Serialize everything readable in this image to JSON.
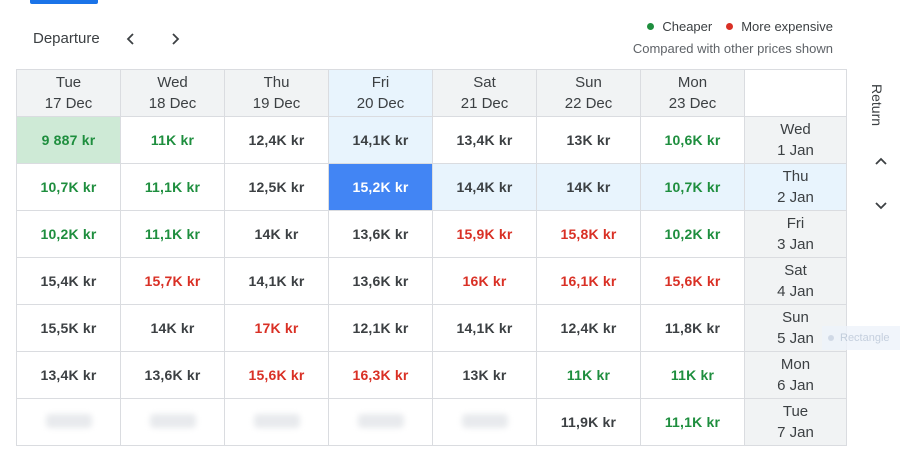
{
  "header": {
    "departure_label": "Departure"
  },
  "legend": {
    "cheaper": "Cheaper",
    "more_expensive": "More expensive",
    "note": "Compared with other prices shown",
    "cheaper_color": "#1e8e3e",
    "expensive_color": "#d93025"
  },
  "return_label": "Return",
  "ghost_label": "Rectangle",
  "columns": [
    {
      "day": "Tue",
      "date": "17 Dec"
    },
    {
      "day": "Wed",
      "date": "18 Dec"
    },
    {
      "day": "Thu",
      "date": "19 Dec"
    },
    {
      "day": "Fri",
      "date": "20 Dec"
    },
    {
      "day": "Sat",
      "date": "21 Dec"
    },
    {
      "day": "Sun",
      "date": "22 Dec"
    },
    {
      "day": "Mon",
      "date": "23 Dec"
    }
  ],
  "rows": [
    {
      "day": "Wed",
      "date": "1 Jan",
      "cells": [
        "9 887 kr",
        "11K kr",
        "12,4K kr",
        "14,1K kr",
        "13,4K kr",
        "13K kr",
        "10,6K kr"
      ]
    },
    {
      "day": "Thu",
      "date": "2 Jan",
      "cells": [
        "10,7K kr",
        "11,1K kr",
        "12,5K kr",
        "15,2K kr",
        "14,4K kr",
        "14K kr",
        "10,7K kr"
      ]
    },
    {
      "day": "Fri",
      "date": "3 Jan",
      "cells": [
        "10,2K kr",
        "11,1K kr",
        "14K kr",
        "13,6K kr",
        "15,9K kr",
        "15,8K kr",
        "10,2K kr"
      ]
    },
    {
      "day": "Sat",
      "date": "4 Jan",
      "cells": [
        "15,4K kr",
        "15,7K kr",
        "14,1K kr",
        "13,6K kr",
        "16K kr",
        "16,1K kr",
        "15,6K kr"
      ]
    },
    {
      "day": "Sun",
      "date": "5 Jan",
      "cells": [
        "15,5K kr",
        "14K kr",
        "17K kr",
        "12,1K kr",
        "14,1K kr",
        "12,4K kr",
        "11,8K kr"
      ]
    },
    {
      "day": "Mon",
      "date": "6 Jan",
      "cells": [
        "13,4K kr",
        "13,6K kr",
        "15,6K kr",
        "16,3K kr",
        "13K kr",
        "11K kr",
        "11K kr"
      ]
    },
    {
      "day": "Tue",
      "date": "7 Jan",
      "cells": [
        "",
        "",
        "",
        "",
        "",
        "11,9K kr",
        "11,1K kr"
      ]
    }
  ]
}
